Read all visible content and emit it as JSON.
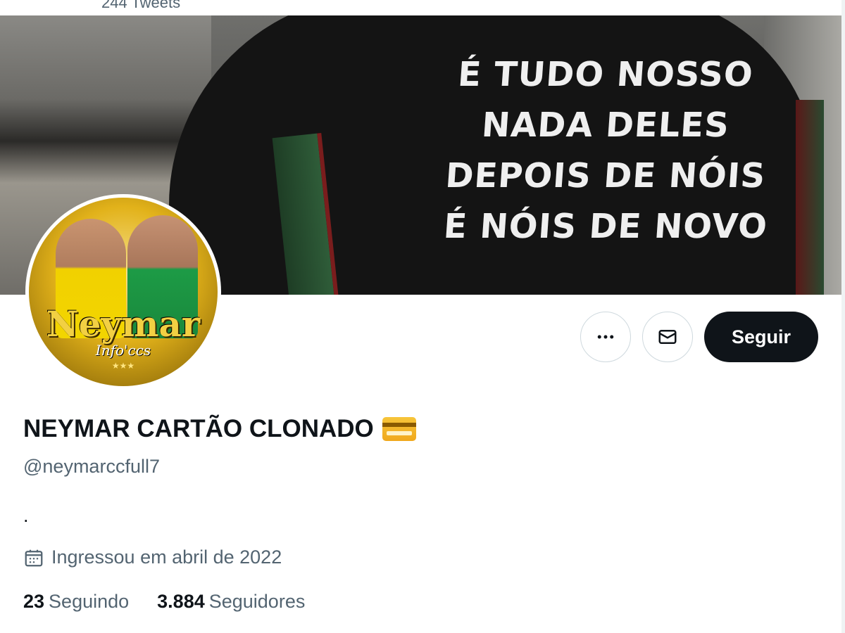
{
  "header": {
    "tweet_count": "244 Tweets"
  },
  "banner": {
    "shirt_lines": [
      "É TUDO NOSSO",
      "NADA DELES",
      "DEPOIS DE NÓIS",
      "É NÓIS DE NOVO"
    ]
  },
  "avatar": {
    "brand": "Neymar",
    "subtitle": "Info'ccs",
    "stars": "★★★"
  },
  "actions": {
    "more_icon": "more-horizontal-icon",
    "message_icon": "envelope-icon",
    "follow_label": "Seguir"
  },
  "profile": {
    "display_name": "NEYMAR CARTÃO CLONADO",
    "name_emoji": "credit-card-icon",
    "handle": "@neymarccfull7",
    "bio": ".",
    "joined_icon": "calendar-icon",
    "joined": "Ingressou em abril de 2022",
    "following_count": "23",
    "following_label": "Seguindo",
    "followers_count": "3.884",
    "followers_label": "Seguidores"
  },
  "colors": {
    "text_primary": "#0f1419",
    "text_secondary": "#536471",
    "button_dark": "#0f1419",
    "border": "#cfd9de"
  }
}
